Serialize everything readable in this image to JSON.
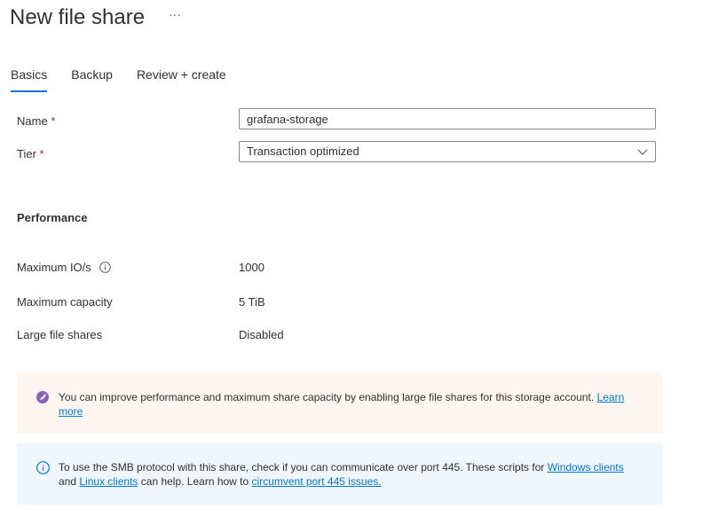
{
  "header": {
    "title": "New file share",
    "more_label": "···"
  },
  "tabs": [
    {
      "label": "Basics",
      "active": true
    },
    {
      "label": "Backup",
      "active": false
    },
    {
      "label": "Review + create",
      "active": false
    }
  ],
  "form": {
    "name_label": "Name",
    "tier_label": "Tier",
    "required_marker": "*",
    "name_value": "grafana-storage",
    "tier_value": "Transaction optimized"
  },
  "performance": {
    "heading": "Performance",
    "rows": [
      {
        "label": "Maximum IO/s",
        "value": "1000",
        "info_icon": "info-icon"
      },
      {
        "label": "Maximum capacity",
        "value": "5 TiB"
      },
      {
        "label": "Large file shares",
        "value": "Disabled"
      }
    ]
  },
  "banners": {
    "warn": {
      "icon": "rocket-icon",
      "text": "You can improve performance and maximum share capacity by enabling large file shares for this storage account.",
      "link": "Learn more",
      "color": "#fdf6f0",
      "icon_color": "#8764b8"
    },
    "info": {
      "icon": "info-icon",
      "text1": "To use the SMB protocol with this share, check if you can communicate over port 445. These scripts for",
      "link1": "Windows clients",
      "text2": "and",
      "link2": "Linux clients",
      "text3": "can help. Learn how to",
      "link3": "circumvent port 445 issues.",
      "color": "#eff6fc"
    }
  },
  "colors": {
    "accent": "#0078d4",
    "required": "#a4262c"
  }
}
